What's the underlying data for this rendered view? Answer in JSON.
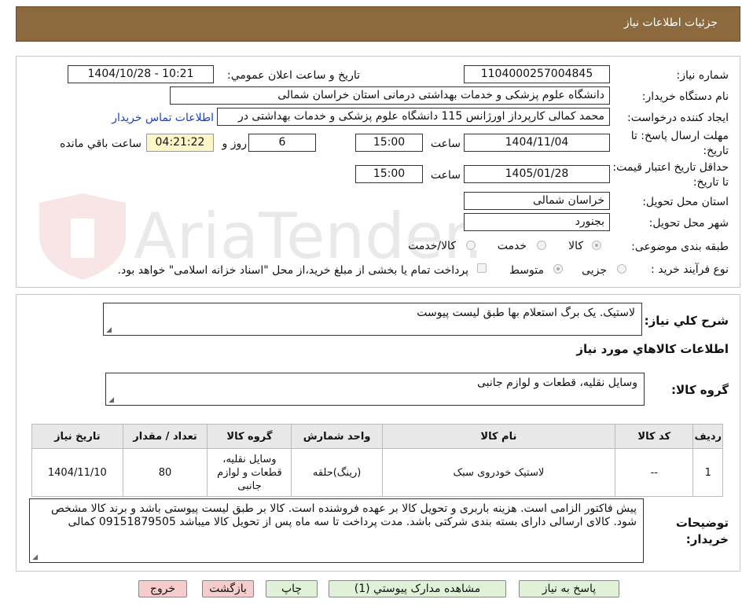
{
  "header": {
    "title": "جزئیات اطلاعات نیاز"
  },
  "form": {
    "need_number_label": "شماره نیاز:",
    "need_number": "1104000257004845",
    "announce_label": "تاریخ و ساعت اعلان عمومي:",
    "announce_value": "1404/10/28 - 10:21",
    "buyer_org_label": "نام دستگاه خریدار:",
    "buyer_org": "دانشگاه علوم پزشکی و خدمات بهداشتی درمانی استان خراسان شمالی",
    "requester_label": "ایجاد کننده درخواست:",
    "requester": "محمد کمالی کارپرداز اورژانس 115 دانشگاه علوم پزشکی و خدمات بهداشتی در",
    "contact_link": "اطلاعات تماس خریدار",
    "deadline_label": "مهلت ارسال پاسخ: تا تاریخ:",
    "deadline_date": "1404/11/04",
    "time_label": "ساعت",
    "deadline_time": "15:00",
    "days_value": "6",
    "days_label": "روز و",
    "remaining_time": "04:21:22",
    "remaining_label": "ساعت باقي مانده",
    "validity_label": "حداقل تاریخ اعتبار قیمت: تا تاریخ:",
    "validity_date": "1405/01/28",
    "validity_time": "15:00",
    "province_label": "استان محل تحویل:",
    "province": "خراسان شمالی",
    "city_label": "شهر محل تحویل:",
    "city": "بجنورد",
    "category_label": "طبقه بندی موضوعی:",
    "category_options": [
      "کالا",
      "خدمت",
      "کالا/خدمت"
    ],
    "process_label": "نوع فرآیند خرید :",
    "process_options": [
      "جزیی",
      "متوسط"
    ],
    "payment_note": "پرداخت تمام یا بخشی از مبلغ خرید،از محل \"اسناد خزانه اسلامی\" خواهد بود."
  },
  "summary": {
    "label": "شرح کلي نياز:",
    "text": "لاستیک. یک برگ استعلام بها طبق لیست پیوست"
  },
  "goods": {
    "section_title": "اطلاعات کالاهاي مورد نياز",
    "group_label": "گروه کالا:",
    "group_text": "وسایل نقلیه، قطعات و لوازم جانبی",
    "columns": [
      "ردیف",
      "کد کالا",
      "نام کالا",
      "واحد شمارش",
      "گروه کالا",
      "تعداد / مقدار",
      "تاریخ نیاز"
    ],
    "rows": [
      {
        "row": "1",
        "code": "--",
        "name": "لاستیک خودروی سبک",
        "unit": "(رینگ)حلقه",
        "group": "وسایل نقلیه، قطعات و لوازم جانبی",
        "qty": "80",
        "date": "1404/11/10"
      }
    ]
  },
  "notes": {
    "label": "توضیحات خریدار:",
    "text": "پیش فاکتور الزامی است. هزینه باربری و تحویل کالا بر عهده فروشنده است. کالا بر طبق لیست پیوستی باشد و برند کالا مشخص شود. کالای ارسالی دارای بسته بندی شرکتی باشد. مدت پرداخت تا سه ماه پس از تحویل کالا میباشد 09151879505 کمالی"
  },
  "buttons": {
    "reply": "پاسخ به نياز",
    "attachments": "مشاهده مدارک پیوستي (1)",
    "print": "چاپ",
    "back": "بازگشت",
    "exit": "خروج"
  },
  "watermark": {
    "text": "AriaTender.neT"
  },
  "colors": {
    "header": "#8c6a3e",
    "link": "#1a3fc8",
    "green_button": "#dff2d8",
    "pink_button": "#f6cccc",
    "timer": "#fff6c8"
  }
}
